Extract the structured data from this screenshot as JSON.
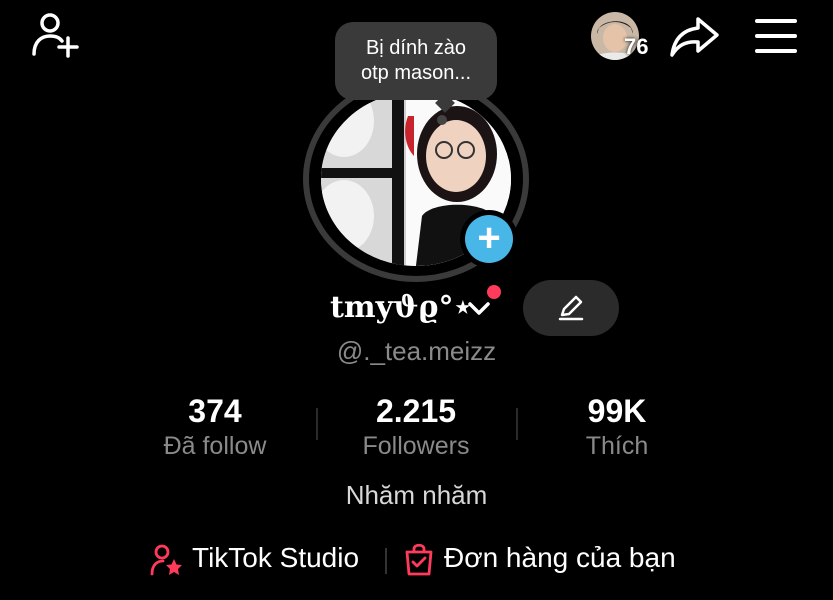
{
  "header": {
    "friends_count": "76",
    "icons": {
      "add_friend": "add-friend-icon",
      "share": "share-icon",
      "menu": "menu-icon"
    }
  },
  "note": {
    "text_line1": "Bị dính zào",
    "text_line2": "otp mason..."
  },
  "profile": {
    "display_name": "tmyϑϱ°⋆",
    "username": "@._tea.meizz",
    "bio": "Nhăm nhăm"
  },
  "stats": [
    {
      "value": "374",
      "label": "Đã follow"
    },
    {
      "value": "2.215",
      "label": "Followers"
    },
    {
      "value": "99K",
      "label": "Thích"
    }
  ],
  "links": {
    "studio": "TikTok Studio",
    "orders": "Đơn hàng của bạn"
  },
  "colors": {
    "background": "#000000",
    "accent_blue": "#49b6e8",
    "notification_red": "#ff3b5c",
    "link_icon_red": "#ff3b5c",
    "muted_text": "#8a8a8a"
  }
}
